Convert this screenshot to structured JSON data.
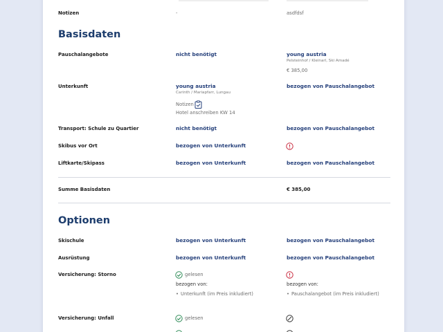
{
  "notizen_row": {
    "label": "Notizen",
    "col1": "-",
    "col2": "asdfdsf"
  },
  "basisdaten": {
    "heading": "Basisdaten",
    "pauschal": {
      "label": "Pauschalangebote",
      "col1": "nicht benötigt",
      "col2_title": "young austria",
      "col2_sub": "Pelsteinhof / Kleinarl, Ski Amadé",
      "col2_price": "€ 385,00"
    },
    "unterkunft": {
      "label": "Unterkunft",
      "col1_title": "young austria",
      "col1_sub": "Carinth / Mariapfarr, Lungau",
      "notes_label": "Notizen",
      "notes_text": "Hotel anschreiben KW 14",
      "col2": "bezogen von Pauschalangebot"
    },
    "transport": {
      "label": "Transport: Schule zu Quartier",
      "col1": "nicht benötigt",
      "col2": "bezogen von Pauschalangebot"
    },
    "skibus": {
      "label": "Skibus vor Ort",
      "col1": "bezogen von Unterkunft"
    },
    "lift": {
      "label": "Liftkarte/Skipass",
      "col1": "bezogen von Unterkunft",
      "col2": "bezogen von Pauschalangebot"
    },
    "summe": {
      "label": "Summe Basisdaten",
      "col2": "€ 385,00"
    }
  },
  "optionen": {
    "heading": "Optionen",
    "skischule": {
      "label": "Skischule",
      "col1": "bezogen von Unterkunft",
      "col2": "bezogen von Pauschalangebot"
    },
    "ausruestung": {
      "label": "Ausrüstung",
      "col1": "bezogen von Unterkunft",
      "col2": "bezogen von Pauschalangebot"
    },
    "storno": {
      "label": "Versicherung: Storno",
      "col1_status": "gelesen",
      "col1_bezogen": "bezogen von:",
      "col1_item": "Unterkunft (im Preis inkludiert)",
      "col2_bezogen": "bezogen von:",
      "col2_item": "Pauschalangebot (im Preis inkludiert)"
    },
    "unfall": {
      "label": "Versicherung: Unfall",
      "col1_status": "gelesen"
    }
  },
  "colors": {
    "bg": "#e3e8f4",
    "heading": "#1d3d6d",
    "link": "#243f7a",
    "error": "#c8283c",
    "success": "#2e8b57"
  }
}
